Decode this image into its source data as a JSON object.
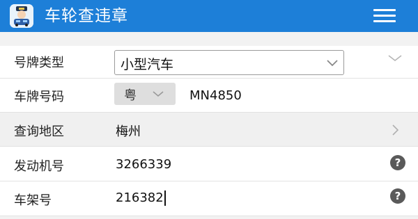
{
  "header": {
    "title": "车轮查违章",
    "background": "#1d7fd8",
    "logo_icon": "police-car-logo-icon",
    "menu_icon": "hamburger-menu-icon"
  },
  "form": {
    "plate_type": {
      "label": "号牌类型",
      "selected": "小型汽车"
    },
    "plate_number": {
      "label": "车牌号码",
      "province": "粤",
      "value": "MN4850"
    },
    "region": {
      "label": "查询地区",
      "value": "梅州"
    },
    "engine_number": {
      "label": "发动机号",
      "value": "3266339"
    },
    "frame_number": {
      "label": "车架号",
      "value": "216382"
    }
  }
}
